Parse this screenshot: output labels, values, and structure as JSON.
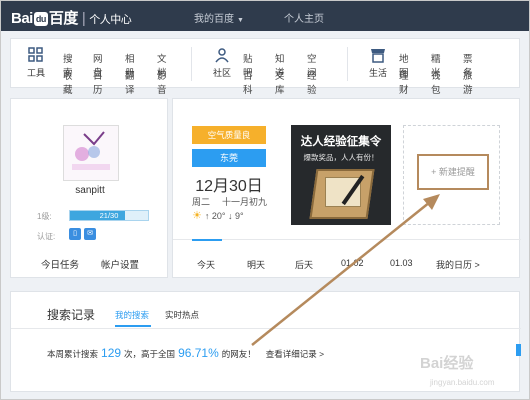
{
  "brand": {
    "logo_prefix": "Bai",
    "logo_paw": "du",
    "logo_suffix": "百度",
    "section": "个人中心"
  },
  "topnav": {
    "my_baidu": "我的百度",
    "homepage": "个人主页"
  },
  "menu": {
    "tools": {
      "label": "工具",
      "items": [
        "搜索",
        "网盘",
        "相册",
        "文档",
        "收藏",
        "日历",
        "翻译",
        "影音"
      ]
    },
    "community": {
      "label": "社区",
      "items": [
        "贴吧",
        "知道",
        "空间",
        "百科",
        "文库",
        "经验"
      ]
    },
    "life": {
      "label": "生活",
      "items": [
        "地图",
        "糯米",
        "票务",
        "理财",
        "钱包",
        "旅游"
      ]
    }
  },
  "profile": {
    "username": "sanpitt",
    "level_label": "1级:",
    "level_progress_text": "21/30",
    "level_progress": 0.7,
    "cert_label": "认证:",
    "today_task": "今日任务",
    "account_settings": "帐户设置"
  },
  "calendar": {
    "aqi": "空气质量良",
    "city": "东莞",
    "date": "12月30日",
    "weekday": "周二",
    "lunar": "十一月初九",
    "temp": "↑ 20° ↓ 9°"
  },
  "banner": {
    "title": "达人经验征集令",
    "subtitle": "爆款奖品，人人有份！"
  },
  "new_reminder": "+ 新建提醒",
  "tabs": [
    "今天",
    "明天",
    "后天",
    "01.02",
    "01.03",
    "我的日历 >"
  ],
  "search_record": {
    "title": "搜索记录",
    "tab_mine": "我的搜索",
    "tab_hot": "实时热点",
    "stat_prefix": "本周累计搜索",
    "count": "129",
    "stat_mid": "次，高于全国",
    "percent": "96.71%",
    "stat_suffix": "的网友！",
    "detail": "查看详细记录 >"
  },
  "watermark": {
    "text": "Bai经验",
    "url": "jingyan.baidu.com"
  },
  "colors": {
    "topbar": "#2f3b4c",
    "accent": "#2c9df1",
    "aqi": "#f6b02b",
    "annotation": "#b58a5d"
  }
}
